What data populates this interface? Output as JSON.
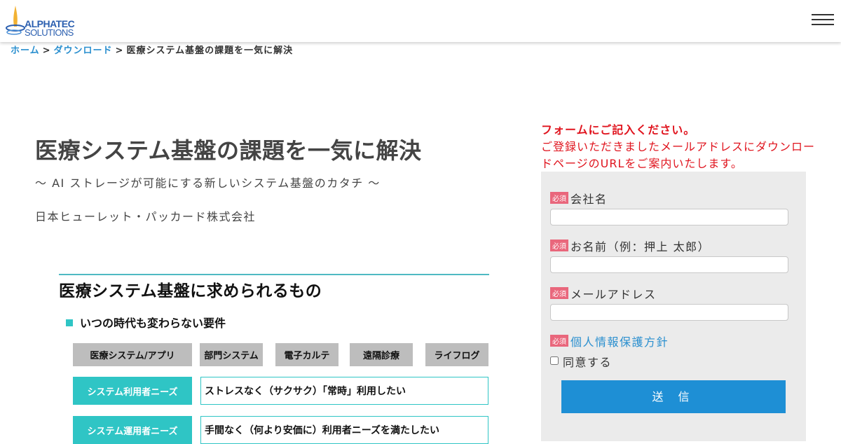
{
  "header": {
    "logo_line1": "ALPHATEC",
    "logo_line2": "SOLUTIONS",
    "menu_icon": "hamburger-menu-icon"
  },
  "breadcrumb": {
    "home": "ホーム",
    "download": "ダウンロード",
    "sep": ">",
    "current": "医療システム基盤の課題を一気に解決"
  },
  "main": {
    "title": "医療システム基盤の課題を一気に解決",
    "subtitle": "～ AI ストレージが可能にする新しいシステム基盤のカタチ ～",
    "company": "日本ヒューレット・パッカード株式会社"
  },
  "figure": {
    "title": "医療システム基盤に求められるもの",
    "subheading": "いつの時代も変わらない要件",
    "categories": [
      "医療システム/アプリ",
      "部門システム",
      "電子カルテ",
      "遠隔診療",
      "ライフログ"
    ],
    "rows": [
      {
        "label": "システム利用者ニーズ",
        "text": "ストレスなく（サクサク）「常時」利用したい"
      },
      {
        "label": "システム運用者ニーズ",
        "text": "手間なく（何より安価に）利用者ニーズを満たしたい"
      }
    ]
  },
  "form": {
    "intro_heading": "フォームにご記入ください。",
    "intro_text": "ご登録いただきましたメールアドレスにダウンロードページのURLをご案内いたします。",
    "required_badge": "必須",
    "fields": [
      {
        "label": "会社名",
        "value": ""
      },
      {
        "label": "お名前（例：押上 太郎）",
        "value": ""
      },
      {
        "label": "メールアドレス",
        "value": ""
      }
    ],
    "policy_link": "個人情報保護方針",
    "agree_label": "同意する",
    "agree_checked": false,
    "submit_label": "送 信"
  },
  "colors": {
    "accent_blue": "#1e8fd5",
    "link_blue": "#2a8fcf",
    "teal": "#2fc5c5",
    "required_pink": "#e9677c",
    "intro_red": "#e0141e",
    "panel_gray": "#ebebeb"
  }
}
